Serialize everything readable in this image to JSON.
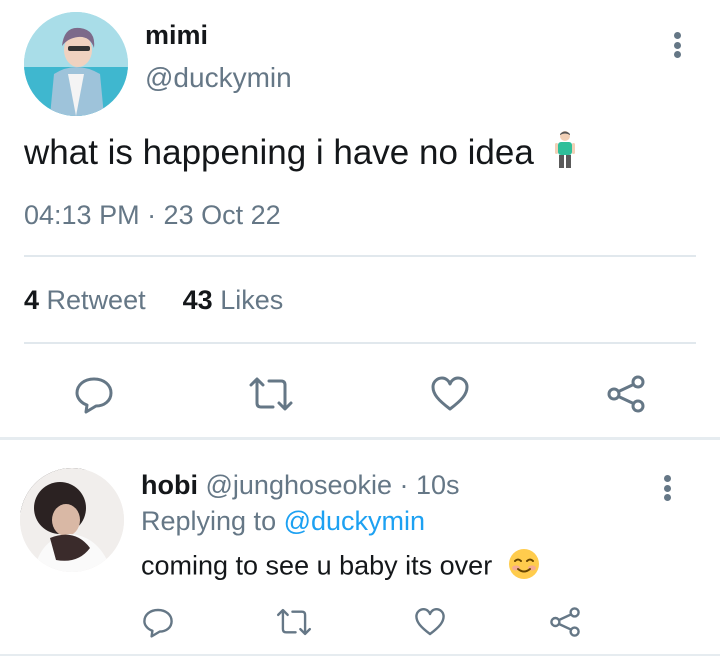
{
  "tweet": {
    "display_name": "mimi",
    "handle": "@duckymin",
    "text": "what is happening i have no idea",
    "emoji": "standing-person-emoji",
    "timestamp": "04:13 PM · 23 Oct 22",
    "retweet_count": "4",
    "retweet_label": "Retweet",
    "like_count": "43",
    "like_label": "Likes",
    "actions": [
      "reply-icon",
      "retweet-icon",
      "like-icon",
      "share-icon"
    ]
  },
  "reply": {
    "display_name": "hobi",
    "handle_time": "@junghoseokie · 10s",
    "replying_prefix": "Replying to",
    "replying_mention": "@duckymin",
    "text": "coming to see u baby its over",
    "emoji": "smiling-face-emoji",
    "actions": [
      "reply-icon",
      "retweet-icon",
      "like-icon",
      "share-icon"
    ]
  },
  "colors": {
    "text_primary": "#14171a",
    "text_secondary": "#657786",
    "accent": "#1da1f2",
    "divider": "#e1e8ed"
  }
}
